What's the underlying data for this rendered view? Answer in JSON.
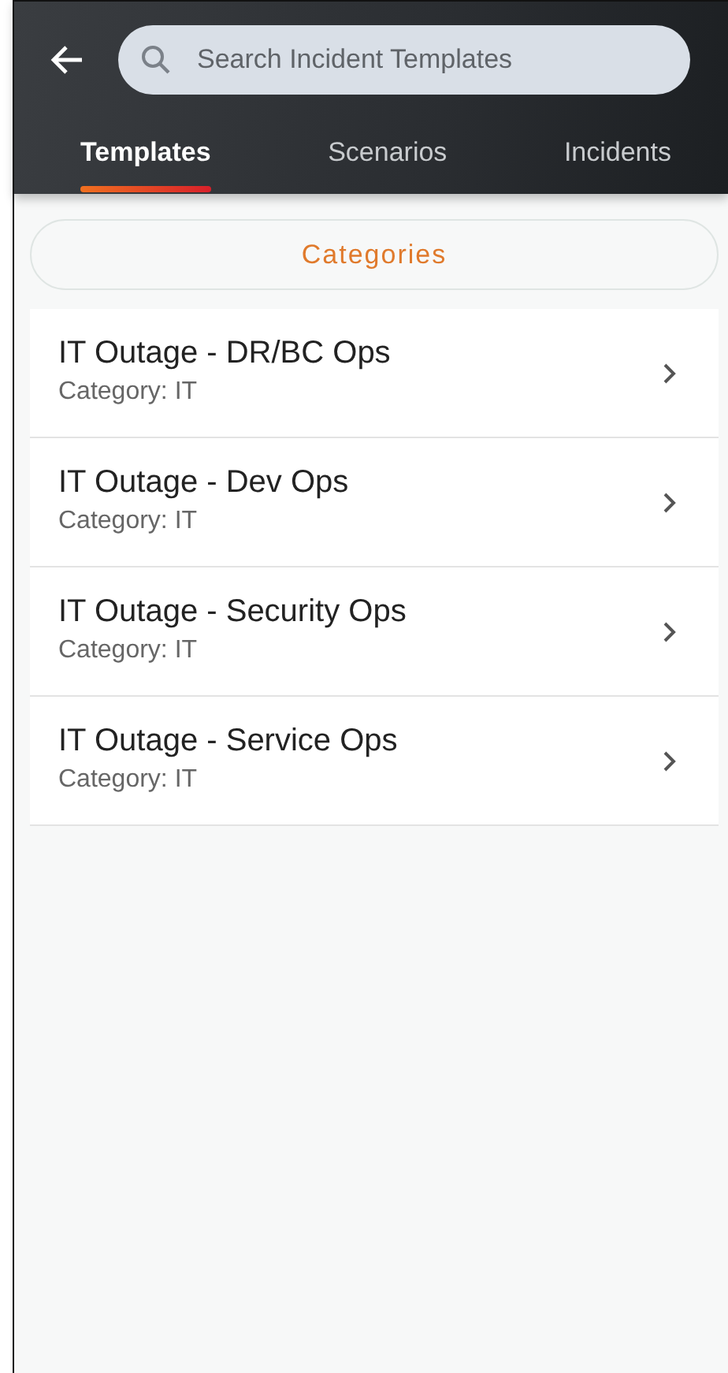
{
  "search": {
    "placeholder": "Search Incident Templates"
  },
  "tabs": [
    {
      "label": "Templates",
      "selected": true
    },
    {
      "label": "Scenarios",
      "selected": false
    },
    {
      "label": "Incidents",
      "selected": false
    }
  ],
  "categories_button": "Categories",
  "templates": [
    {
      "title": "IT Outage - DR/BC Ops",
      "category": "Category: IT"
    },
    {
      "title": "IT Outage - Dev Ops",
      "category": "Category: IT"
    },
    {
      "title": "IT Outage - Security Ops",
      "category": "Category: IT"
    },
    {
      "title": "IT Outage - Service Ops",
      "category": "Category: IT"
    }
  ]
}
